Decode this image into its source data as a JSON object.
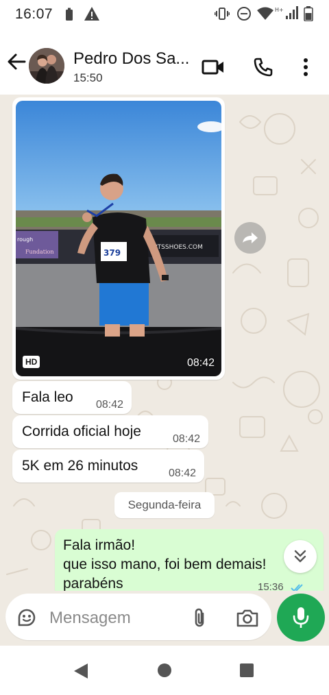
{
  "status_bar": {
    "time": "16:07",
    "icons": [
      "battery-saver-icon",
      "warning-icon",
      "vibrate-icon",
      "do-not-disturb-icon",
      "wifi-icon",
      "signal-hplus-icon",
      "battery-icon"
    ]
  },
  "header": {
    "contact_name": "Pedro Dos Sa...",
    "status": "15:50",
    "actions": [
      "video-call-icon",
      "phone-icon",
      "more-vert-icon"
    ]
  },
  "messages": {
    "media": {
      "badge": "HD",
      "time": "08:42"
    },
    "incoming": [
      {
        "text": "Fala leo",
        "time": "08:42"
      },
      {
        "text": "Corrida oficial hoje",
        "time": "08:42"
      },
      {
        "text": "5K em 26 minutos",
        "time": "08:42"
      }
    ],
    "date_divider": "Segunda-feira",
    "outgoing": {
      "lines": [
        "Fala irmão!",
        "que isso mano, foi bem demais!",
        "parabéns"
      ],
      "time": "15:36"
    }
  },
  "composer": {
    "placeholder": "Mensagem"
  },
  "colors": {
    "chat_bg": "#efeae2",
    "incoming_bubble": "#ffffff",
    "outgoing_bubble": "#d9fdd3",
    "mic_button": "#1fa855",
    "read_ticks": "#53bdeb"
  }
}
